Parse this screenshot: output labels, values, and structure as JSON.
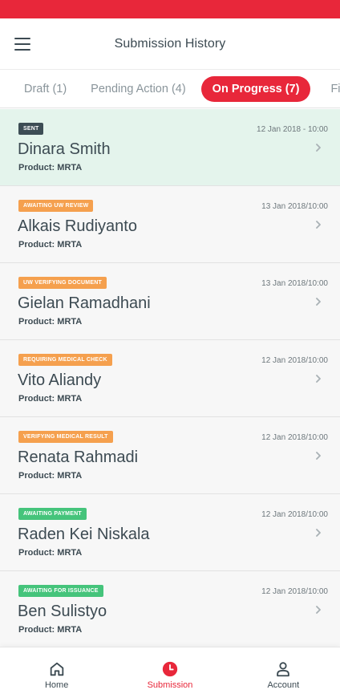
{
  "header": {
    "title": "Submission History"
  },
  "tabs": [
    {
      "label": "Draft (1)"
    },
    {
      "label": "Pending Action (4)"
    },
    {
      "label": "On Progress (7)"
    },
    {
      "label": "Finis"
    }
  ],
  "colors": {
    "accent": "#e8273a",
    "sent": "#3d4d55",
    "orange": "#f5a04e",
    "green": "#45c47b",
    "highlight": "#e4f4ec"
  },
  "submissions": [
    {
      "status": "SENT",
      "status_color": "#3d4d55",
      "date": "12 Jan 2018 - 10:00",
      "name": "Dinara Smith",
      "product": "Product: MRTA"
    },
    {
      "status": "AWAITING UW REVIEW",
      "status_color": "#f5a04e",
      "date": "13 Jan 2018/10:00",
      "name": "Alkais Rudiyanto",
      "product": "Product: MRTA"
    },
    {
      "status": "UW VERIFYING DOCUMENT",
      "status_color": "#f5a04e",
      "date": "13 Jan 2018/10:00",
      "name": "Gielan Ramadhani",
      "product": "Product: MRTA"
    },
    {
      "status": "REQUIRING MEDICAL CHECK",
      "status_color": "#f5a04e",
      "date": "12 Jan 2018/10:00",
      "name": "Vito Aliandy",
      "product": "Product: MRTA"
    },
    {
      "status": "VERIFYING MEDICAL RESULT",
      "status_color": "#f5a04e",
      "date": "12 Jan 2018/10:00",
      "name": "Renata Rahmadi",
      "product": "Product: MRTA"
    },
    {
      "status": "AWAITING PAYMENT",
      "status_color": "#45c47b",
      "date": "12 Jan 2018/10:00",
      "name": "Raden Kei Niskala",
      "product": "Product: MRTA"
    },
    {
      "status": "AWAITING FOR ISSUANCE",
      "status_color": "#45c47b",
      "date": "12 Jan 2018/10:00",
      "name": "Ben Sulistyo",
      "product": "Product: MRTA"
    }
  ],
  "bottom_nav": [
    {
      "label": "Home",
      "icon": "home-icon"
    },
    {
      "label": "Submission",
      "icon": "clock-icon"
    },
    {
      "label": "Account",
      "icon": "user-icon"
    }
  ]
}
